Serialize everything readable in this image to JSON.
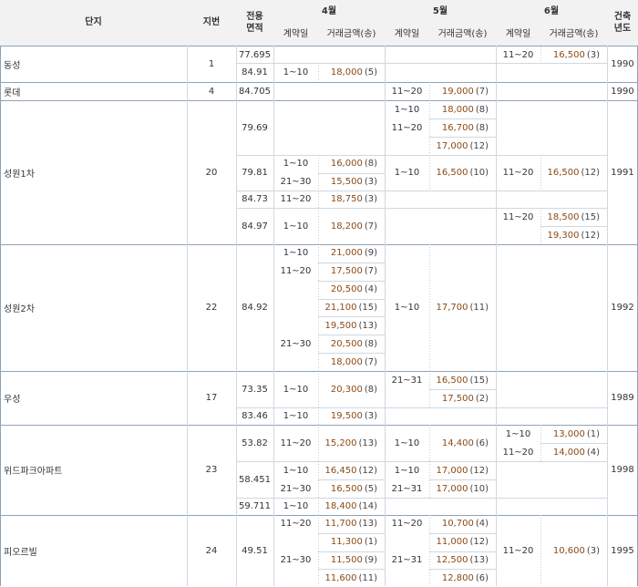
{
  "header": {
    "complex": "단지",
    "lot": "지번",
    "area": "전용\n면적",
    "month_apr": "4월",
    "month_may": "5월",
    "month_jun": "6월",
    "year": "건축\n년도",
    "contract_day": "계약일",
    "amount": "거래금액(송)"
  },
  "colors": {
    "border_strong": "#8fa3b8",
    "border_light": "#cfd8e1",
    "border_dot": "#c3ccd6",
    "header_bg": "#f2f2f2",
    "price": "#8a4a16"
  },
  "complexes": [
    {
      "name": "동성",
      "lot": "1",
      "year": "1990",
      "areas": [
        {
          "area": "77.695",
          "h": 18,
          "m4": [],
          "m5": [],
          "m6": [
            {
              "d": "11~20",
              "p": "16,500",
              "c": "(3)"
            }
          ]
        },
        {
          "area": "84.91",
          "h": 21,
          "m4": [
            {
              "d": "1~10",
              "p": "18,000",
              "c": "(5)"
            }
          ],
          "m5": [],
          "m6": []
        }
      ]
    },
    {
      "name": "롯데",
      "lot": "4",
      "year": "1990",
      "areas": [
        {
          "area": "84.705",
          "h": 20,
          "m4": [],
          "m5": [
            {
              "d": "11~20",
              "p": "19,000",
              "c": "(7)"
            }
          ],
          "m6": []
        }
      ]
    },
    {
      "name": "성원1차",
      "lot": "20",
      "year": "1991",
      "areas": [
        {
          "area": "79.69",
          "h": 60,
          "m4": [],
          "m5": [
            {
              "d": "1~10",
              "p": "18,000",
              "c": "(8)"
            },
            {
              "d": "11~20",
              "p": "16,700",
              "c": "(8)"
            },
            {
              "p": "17,000",
              "c": "(12)"
            }
          ],
          "m6": []
        },
        {
          "area": "79.81",
          "h": 39,
          "m4": [
            {
              "d": "1~10",
              "p": "16,000",
              "c": "(8)"
            },
            {
              "d": "21~30",
              "p": "15,500",
              "c": "(3)"
            }
          ],
          "m5": [
            {
              "d": "1~10",
              "p": "16,500",
              "c": "(10)"
            }
          ],
          "m6": [
            {
              "d": "11~20",
              "p": "16,500",
              "c": "(12)"
            }
          ]
        },
        {
          "area": "84.73",
          "h": 19,
          "m4": [
            {
              "d": "11~20",
              "p": "18,750",
              "c": "(3)"
            }
          ],
          "m5": [],
          "m6": []
        },
        {
          "area": "84.97",
          "h": 40,
          "m4": [
            {
              "d": "1~10",
              "p": "18,200",
              "c": "(7)"
            }
          ],
          "m5": [],
          "m6": [
            {
              "d": "11~20",
              "p": "18,500",
              "c": "(15)"
            },
            {
              "p": "19,300",
              "c": "(12)"
            }
          ]
        }
      ]
    },
    {
      "name": "성원2차",
      "lot": "22",
      "year": "1992",
      "areas": [
        {
          "area": "84.92",
          "h": 139,
          "m4": [
            {
              "d": "1~10",
              "p": "21,000",
              "c": "(9)"
            },
            {
              "d": "11~20",
              "p": "17,500",
              "c": "(7)"
            },
            {
              "p": "20,500",
              "c": "(4)"
            },
            {
              "p": "21,100",
              "c": "(15)"
            },
            {
              "p": "19,500",
              "c": "(13)"
            },
            {
              "d": "21~30",
              "p": "20,500",
              "c": "(8)"
            },
            {
              "p": "18,000",
              "c": "(7)"
            }
          ],
          "m5": [
            {
              "d": "1~10",
              "p": "17,700",
              "c": "(11)"
            }
          ],
          "m6": []
        }
      ]
    },
    {
      "name": "우성",
      "lot": "17",
      "year": "1989",
      "areas": [
        {
          "area": "73.35",
          "h": 40,
          "m4": [
            {
              "d": "1~10",
              "p": "20,300",
              "c": "(8)"
            }
          ],
          "m5": [
            {
              "d": "21~31",
              "p": "16,500",
              "c": "(15)"
            },
            {
              "p": "17,500",
              "c": "(2)"
            }
          ],
          "m6": []
        },
        {
          "area": "83.46",
          "h": 19,
          "m4": [
            {
              "d": "1~10",
              "p": "19,500",
              "c": "(3)"
            }
          ],
          "m5": [],
          "m6": []
        }
      ]
    },
    {
      "name": "위드파크아파트",
      "lot": "23",
      "year": "1998",
      "areas": [
        {
          "area": "53.82",
          "h": 40,
          "m4": [
            {
              "d": "11~20",
              "p": "15,200",
              "c": "(13)"
            }
          ],
          "m5": [
            {
              "d": "1~10",
              "p": "14,400",
              "c": "(6)"
            }
          ],
          "m6": [
            {
              "d": "1~10",
              "p": "13,000",
              "c": "(1)"
            },
            {
              "d": "11~20",
              "p": "14,000",
              "c": "(4)"
            }
          ]
        },
        {
          "area": "58.451",
          "h": 40,
          "m4": [
            {
              "d": "1~10",
              "p": "16,450",
              "c": "(12)"
            },
            {
              "d": "21~30",
              "p": "16,500",
              "c": "(5)"
            }
          ],
          "m5": [
            {
              "d": "1~10",
              "p": "17,000",
              "c": "(12)"
            },
            {
              "d": "21~31",
              "p": "17,000",
              "c": "(10)"
            }
          ],
          "m6": []
        },
        {
          "area": "59.711",
          "h": 19,
          "m4": [
            {
              "d": "1~10",
              "p": "18,400",
              "c": "(14)"
            }
          ],
          "m5": [],
          "m6": []
        }
      ]
    },
    {
      "name": "피오르빌",
      "lot": "24",
      "year": "1995",
      "areas": [
        {
          "area": "49.51",
          "h": 79,
          "m4": [
            {
              "d": "11~20",
              "p": "11,700",
              "c": "(13)"
            },
            {
              "p": "11,300",
              "c": "(1)"
            },
            {
              "d": "21~30",
              "p": "11,500",
              "c": "(9)"
            },
            {
              "p": "11,600",
              "c": "(11)"
            }
          ],
          "m5": [
            {
              "d": "11~20",
              "p": "10,700",
              "c": "(4)"
            },
            {
              "p": "11,000",
              "c": "(12)"
            },
            {
              "d": "21~31",
              "p": "12,500",
              "c": "(13)"
            },
            {
              "p": "12,800",
              "c": "(6)"
            }
          ],
          "m6": [
            {
              "d": "11~20",
              "p": "10,600",
              "c": "(3)"
            }
          ]
        }
      ]
    }
  ]
}
